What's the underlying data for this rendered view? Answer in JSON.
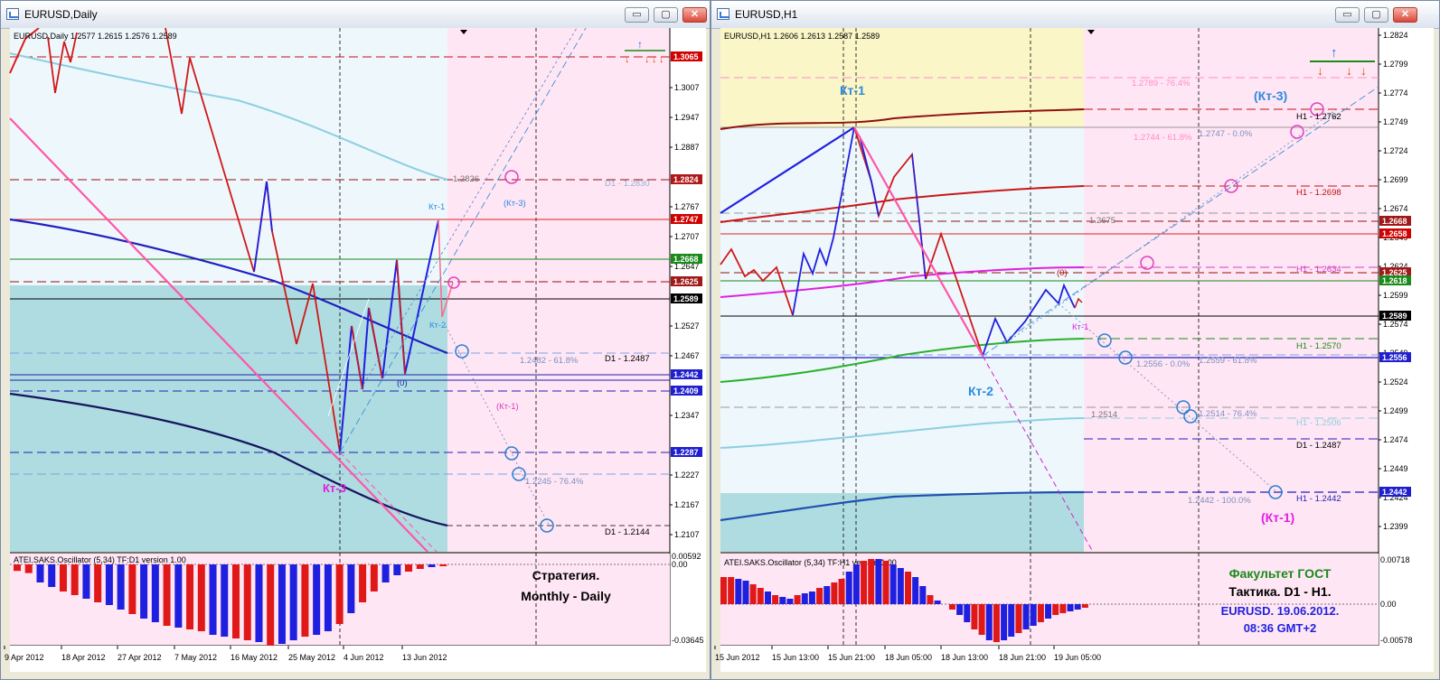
{
  "left": {
    "title": "EURUSD,Daily",
    "header": "EURUSD,Daily  1.2577 1.2615 1.2576 1.2589",
    "price_ticks": [
      "1.3007",
      "1.2947",
      "1.2887",
      "1.2767",
      "1.2707",
      "1.2647",
      "1.2527",
      "1.2467",
      "1.2347",
      "1.2227",
      "1.2167",
      "1.2107"
    ],
    "price_boxes": [
      {
        "value": "1.3065",
        "bg": "#D00000"
      },
      {
        "value": "1.2824",
        "bg": "#B01818"
      },
      {
        "value": "1.2747",
        "bg": "#D00000"
      },
      {
        "value": "1.2668",
        "bg": "#1A8A1A"
      },
      {
        "value": "1.2625",
        "bg": "#A01818"
      },
      {
        "value": "1.2589",
        "bg": "#000000"
      },
      {
        "value": "1.2442",
        "bg": "#1F1FD0"
      },
      {
        "value": "1.2409",
        "bg": "#1F1FD0"
      },
      {
        "value": "1.2287",
        "bg": "#1F1FD0"
      }
    ],
    "labels": {
      "kt1": "Кт-1",
      "kt2": "Кт-2",
      "kt3_paren": "(Кт-3)",
      "kt1_paren": "(Кт-1)",
      "zero": "(0)",
      "kt3": "Кт-3",
      "v2826": "1.2826",
      "d1_2830": "D1 - 1.2830",
      "fib618": "1.2482 - 61.8%",
      "d1_2487": "D1 - 1.2487",
      "fib764": "1.2245 - 76.4%",
      "d1_2144": "D1 - 1.2144",
      "d1_2442_hidden": "1.2442"
    },
    "osc_title": "ATEI.SAKS.Oscillator (5,34)  TF:D1  version 1.00",
    "osc_ticks": [
      "0.00592",
      "0.00",
      "-0.03645"
    ],
    "date_ticks": [
      "9 Apr 2012",
      "18 Apr 2012",
      "27 Apr 2012",
      "7 May 2012",
      "16 May 2012",
      "25 May 2012",
      "4 Jun 2012",
      "13 Jun 2012"
    ],
    "note_line1": "Стратегия.",
    "note_line2": "Monthly - Daily"
  },
  "right": {
    "title": "EURUSD,H1",
    "header": "EURUSD,H1  1.2606 1.2613 1.2587 1.2589",
    "price_ticks": [
      "1.2824",
      "1.2799",
      "1.2774",
      "1.2749",
      "1.2724",
      "1.2699",
      "1.2674",
      "1.2649",
      "1.2624",
      "1.2599",
      "1.2574",
      "1.2549",
      "1.2524",
      "1.2499",
      "1.2474",
      "1.2449",
      "1.2424",
      "1.2399"
    ],
    "price_boxes": [
      {
        "value": "1.2668",
        "bg": "#A01818"
      },
      {
        "value": "1.2658",
        "bg": "#D00000"
      },
      {
        "value": "1.2625",
        "bg": "#A01818"
      },
      {
        "value": "1.2618",
        "bg": "#1A8A1A"
      },
      {
        "value": "1.2589",
        "bg": "#000000"
      },
      {
        "value": "1.2556",
        "bg": "#1F1FD0"
      },
      {
        "value": "1.2442",
        "bg": "#1F1FD0"
      }
    ],
    "labels": {
      "kt1": "Кт-1",
      "kt3_paren": "(Кт-3)",
      "kt2": "Кт-2",
      "kt1_pink": "Кт-1",
      "zero": "(0)",
      "kt1_paren": "(Кт-1)",
      "fib2789": "1.2789 - 76.4%",
      "fib2744": "1.2744 - 61.8%",
      "fib2747": "1.2747 - 0.0%",
      "h1_2762": "H1 - 1.2762",
      "h1_2698": "H1 - 1.2698",
      "v2675": "1.2675",
      "h1_2634": "H1 - 1.2634",
      "h1_2570": "H1 - 1.2570",
      "fib2556": "1.2556 - 0.0%",
      "fib2559": "1.2559 - 61.8%",
      "v2514": "1.2514",
      "fib2514": "1.2514 - 76.4%",
      "h1_2506": "H1 - 1.2506",
      "d1_2487": "D1 - 1.2487",
      "fib2442": "1.2442 - 100.0%",
      "h1_2442": "H1 - 1.2442"
    },
    "osc_title": "ATEI.SAKS.Oscillator (5,34)  TF:H1  version 1.00",
    "osc_ticks": [
      "0.00718",
      "0.00",
      "-0.00578"
    ],
    "date_ticks": [
      "15 Jun 2012",
      "15 Jun 13:00",
      "15 Jun 21:00",
      "18 Jun 05:00",
      "18 Jun 13:00",
      "18 Jun 21:00",
      "19 Jun 05:00"
    ],
    "note_line1": "Факультет ГОСТ",
    "note_line2": "Тактика. D1 - H1.",
    "note_line3": "EURUSD. 19.06.2012.",
    "note_line4": "08:36  GMT+2"
  },
  "window_buttons": {
    "minimize": "▭",
    "maximize": "▢",
    "close": "✕"
  },
  "colors": {
    "bull": "#1F1FE0",
    "bear": "#E01818",
    "pink": "#FF55AA",
    "fib_blue": "#5A7FCC"
  }
}
